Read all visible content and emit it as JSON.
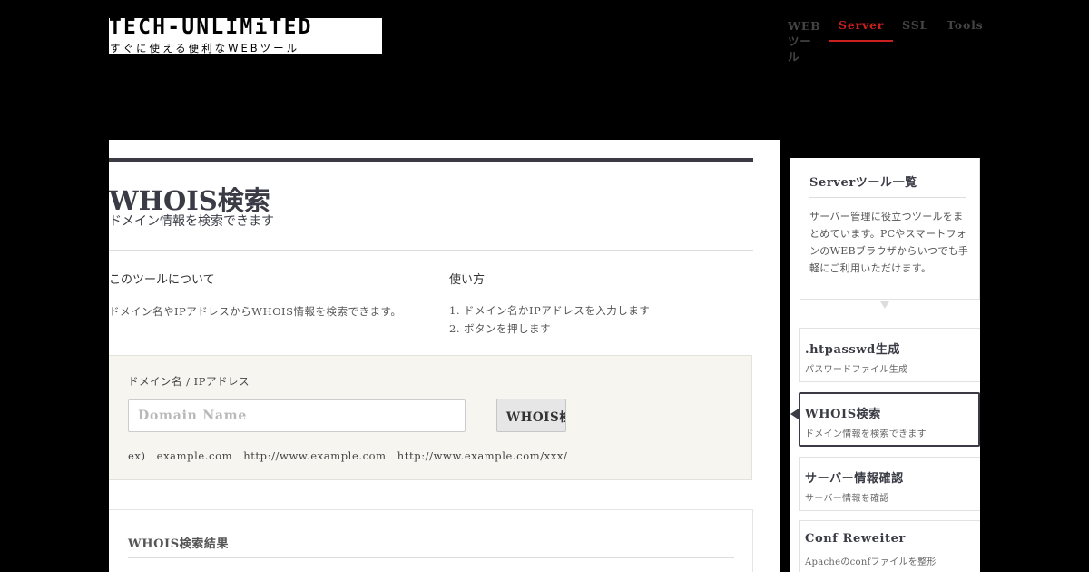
{
  "header": {
    "logo_text": "TECH-UNLIMiTED",
    "logo_tagline": "すぐに使える便利なWEBツール",
    "nav": [
      {
        "label": "WEB ツール",
        "active": false
      },
      {
        "label": "Server",
        "active": true
      },
      {
        "label": "SSL",
        "active": false
      },
      {
        "label": "Tools",
        "active": false
      }
    ]
  },
  "page": {
    "title": "WHOIS検索",
    "subtitle": "ドメイン情報を検索できます",
    "about_heading": "このツールについて",
    "about_text": "ドメイン名やIPアドレスからWHOIS情報を検索できます。",
    "usage_heading": "使い方",
    "usage_steps": [
      "ドメイン名かIPアドレスを入力します",
      "ボタンを押します"
    ]
  },
  "form": {
    "label": "ドメイン名 / IPアドレス",
    "placeholder": "Domain Name",
    "value": "",
    "button_label": "WHOIS検索",
    "example": "ex)　example.com　http://www.example.com　http://www.example.com/xxx/"
  },
  "results": {
    "title": "WHOIS検索結果"
  },
  "sidebar": {
    "info_title": "Serverツール一覧",
    "info_text": "サーバー管理に役立つツールをまとめています。PCやスマートフォンのWEBブラウザからいつでも手軽にご利用いただけます。",
    "tools": [
      {
        "title": ".htpasswd生成",
        "desc": "パスワードファイル生成",
        "selected": false
      },
      {
        "title": "WHOIS検索",
        "desc": "ドメイン情報を検索できます",
        "selected": true
      },
      {
        "title": "サーバー情報確認",
        "desc": "サーバー情報を確認",
        "selected": false
      },
      {
        "title": "Conf Reweiter",
        "desc": "Apacheのconfファイルを整形",
        "selected": false
      }
    ]
  },
  "colors": {
    "background": "#000000",
    "accent_red": "#cc1f1f",
    "heading_dark": "#3a3b44",
    "form_bg": "#f6f5ef"
  }
}
